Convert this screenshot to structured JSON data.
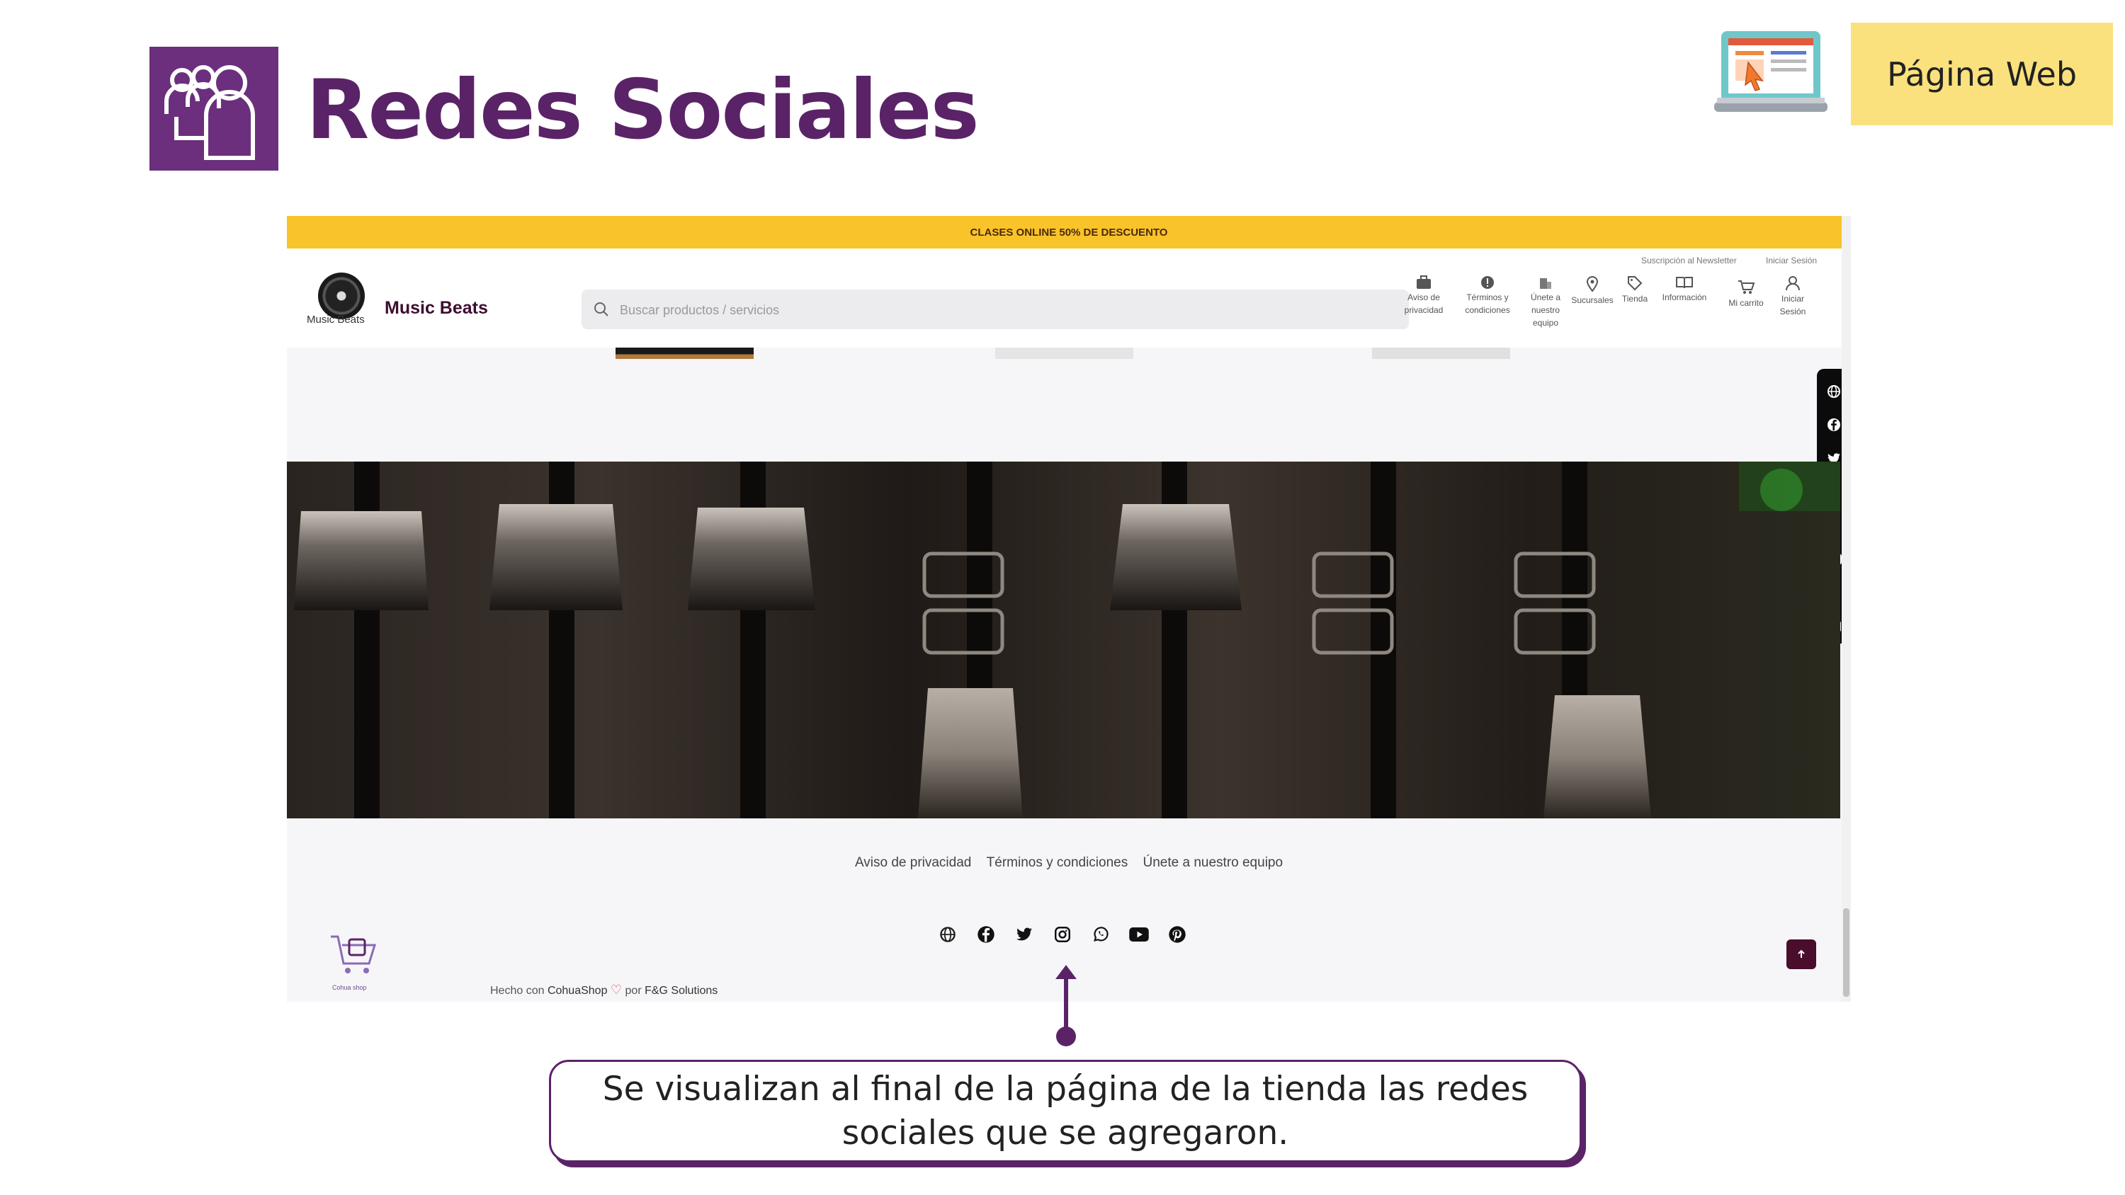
{
  "slide": {
    "title": "Redes Sociales",
    "badge": "Página Web",
    "callout": "Se visualizan al final de la página de la tienda las redes sociales que se agregaron.",
    "accent_color": "#5b2367",
    "badge_color": "#fbe17d"
  },
  "store": {
    "promo_banner": "CLASES ONLINE 50% DE DESCUENTO",
    "logo_caption": "Music Beats",
    "brand_name": "Music Beats",
    "search_placeholder": "Buscar productos / servicios",
    "top_links": [
      "Suscripción al Newsletter",
      "Iniciar Sesión"
    ],
    "nav": [
      {
        "label": "Aviso de privacidad",
        "icon": "briefcase-icon"
      },
      {
        "label": "Términos y condiciones",
        "icon": "alert-icon"
      },
      {
        "label": "Únete a nuestro equipo",
        "icon": "building-icon"
      },
      {
        "label": "Sucursales",
        "icon": "map-pin-icon"
      },
      {
        "label": "Tienda",
        "icon": "tag-icon"
      },
      {
        "label": "Información",
        "icon": "book-icon"
      },
      {
        "label": "Mi carrito",
        "icon": "cart-icon"
      },
      {
        "label": "Iniciar Sesión",
        "icon": "user-icon"
      }
    ],
    "social_rail": [
      "globe-icon",
      "facebook-icon",
      "twitter-icon",
      "instagram-icon",
      "whatsapp-icon",
      "youtube-icon",
      "pinterest-icon",
      "email-icon"
    ],
    "footer_links": [
      "Aviso de privacidad",
      "Términos y condiciones",
      "Únete a nuestro equipo"
    ],
    "footer_social": [
      "globe-icon",
      "facebook-icon",
      "twitter-icon",
      "instagram-icon",
      "whatsapp-icon",
      "youtube-icon",
      "pinterest-icon"
    ],
    "cohua_caption": "Cohua shop",
    "made_with": "Hecho con",
    "made_with_brand": "CohuaShop",
    "made_by": "por",
    "made_by_brand": "F&G Solutions"
  }
}
